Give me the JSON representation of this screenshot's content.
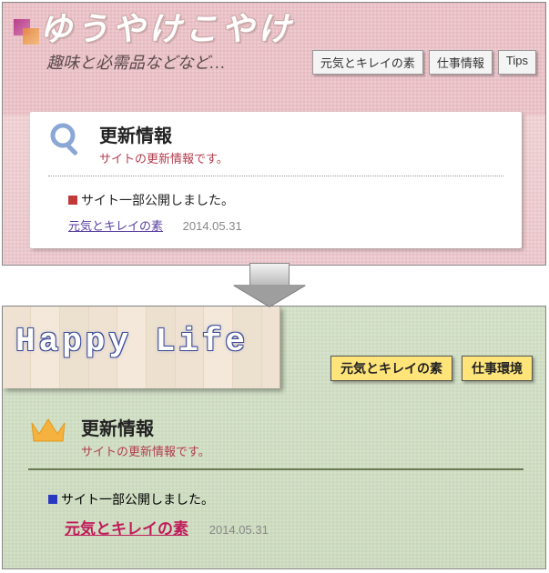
{
  "top": {
    "site_title": "ゆうやけこやけ",
    "tagline": "趣味と必需品などなど…",
    "nav": [
      {
        "label": "元気とキレイの素"
      },
      {
        "label": "仕事情報"
      },
      {
        "label": "Tips"
      }
    ],
    "card": {
      "title": "更新情報",
      "subtitle": "サイトの更新情報です。",
      "entry_title": "サイト一部公開しました。",
      "link_label": "元気とキレイの素",
      "date": "2014.05.31"
    }
  },
  "bottom": {
    "site_title": "Happy Life",
    "nav": [
      {
        "label": "元気とキレイの素"
      },
      {
        "label": "仕事環境"
      }
    ],
    "card": {
      "title": "更新情報",
      "subtitle": "サイトの更新情報です。",
      "entry_title": "サイト一部公開しました。",
      "link_label": "元気とキレイの素",
      "date": "2014.05.31"
    }
  }
}
